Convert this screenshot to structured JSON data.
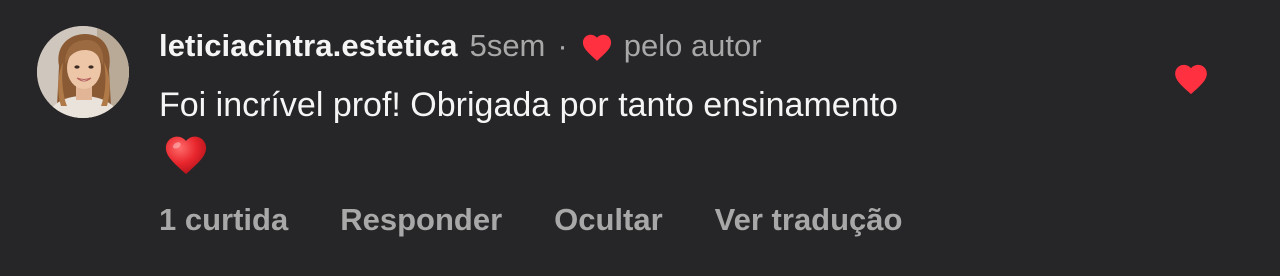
{
  "comment": {
    "username": "leticiacintra.estetica",
    "time": "5sem",
    "separator": "·",
    "liked_by_author_label": "pelo autor",
    "text": "Foi incrível prof! Obrigada por tanto ensinamento",
    "emoji_icon": "red-heart-emoji",
    "like_icon": "heart-filled-icon",
    "colors": {
      "heart": "#ff3040",
      "emoji_heart": "#e8262d",
      "secondary_text": "#a8a8a8",
      "background": "#262527"
    }
  },
  "actions": {
    "likes": "1 curtida",
    "reply": "Responder",
    "hide": "Ocultar",
    "translate": "Ver tradução"
  }
}
